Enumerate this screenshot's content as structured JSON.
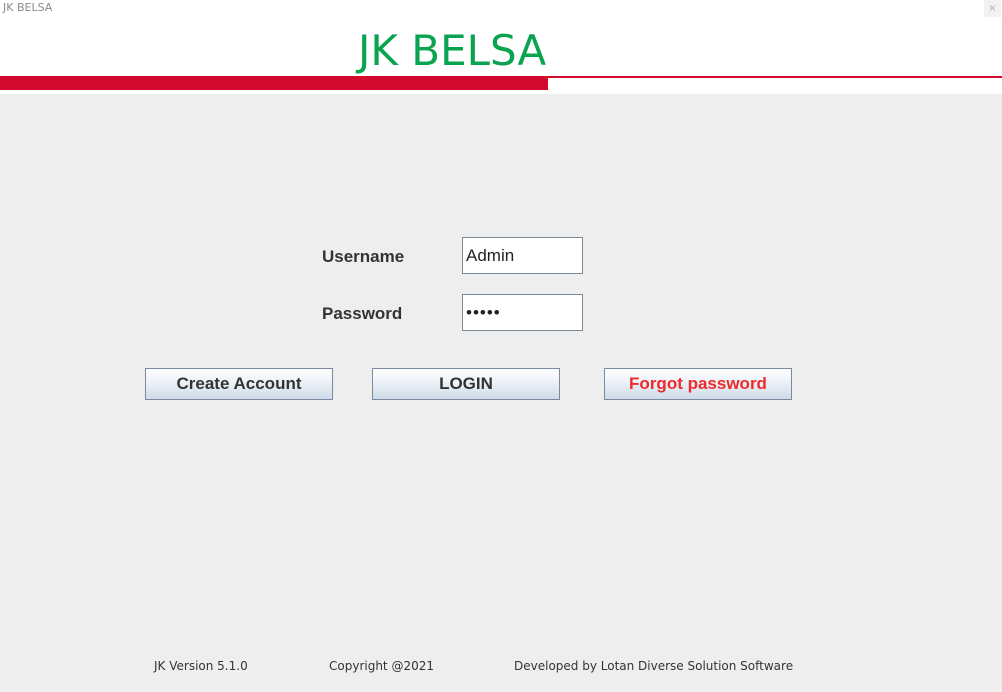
{
  "window": {
    "title": "JK BELSA",
    "close_glyph": "×"
  },
  "header": {
    "logo_text": "JK BELSA",
    "logo_color": "#0aa34f",
    "stripe_color": "#d20a2e"
  },
  "form": {
    "username_label": "Username",
    "username_value": "Admin",
    "password_label": "Password",
    "password_value": "•••••"
  },
  "buttons": {
    "create_account": "Create Account",
    "login": "LOGIN",
    "forgot_password": "Forgot password",
    "forgot_color": "#ee2a2a"
  },
  "footer": {
    "version": "JK Version 5.1.0",
    "copyright": "Copyright @2021",
    "developer": "Developed by Lotan Diverse Solution Software"
  }
}
